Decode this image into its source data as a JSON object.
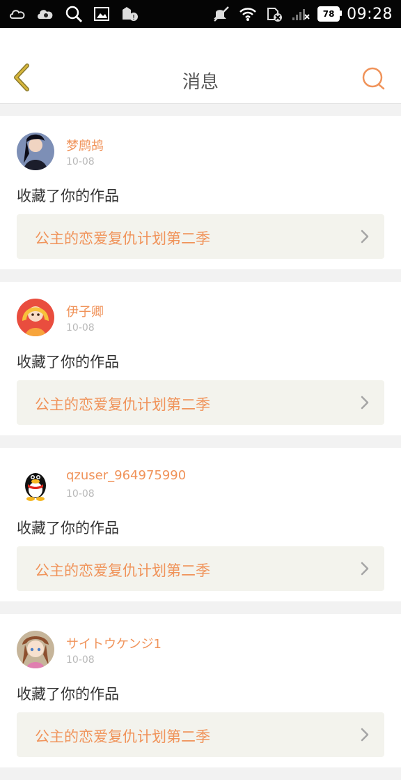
{
  "status_bar": {
    "time": "09:28",
    "battery": "78",
    "icons_left": [
      "weather-icon",
      "cloud-message-icon",
      "search-icon",
      "image-icon",
      "app-update-icon"
    ],
    "icons_right": [
      "mute-icon",
      "wifi-icon",
      "sim-off-icon",
      "signal-icon",
      "battery-icon"
    ]
  },
  "header": {
    "title": "消息"
  },
  "colors": {
    "accent": "#f0935a",
    "back_chevron": "#c8a62b",
    "work_box_bg": "#f3f3ed",
    "page_bg": "#f2f2f2"
  },
  "messages": [
    {
      "user": "梦鹧鸪",
      "date": "10-08",
      "action": "收藏了你的作品",
      "work": "公主的恋爱复仇计划第二季"
    },
    {
      "user": "伊子卿",
      "date": "10-08",
      "action": "收藏了你的作品",
      "work": "公主的恋爱复仇计划第二季"
    },
    {
      "user": "qzuser_964975990",
      "date": "10-08",
      "action": "收藏了你的作品",
      "work": "公主的恋爱复仇计划第二季"
    },
    {
      "user": "サイトウケンジ1",
      "date": "10-08",
      "action": "收藏了你的作品",
      "work": "公主的恋爱复仇计划第二季"
    }
  ]
}
